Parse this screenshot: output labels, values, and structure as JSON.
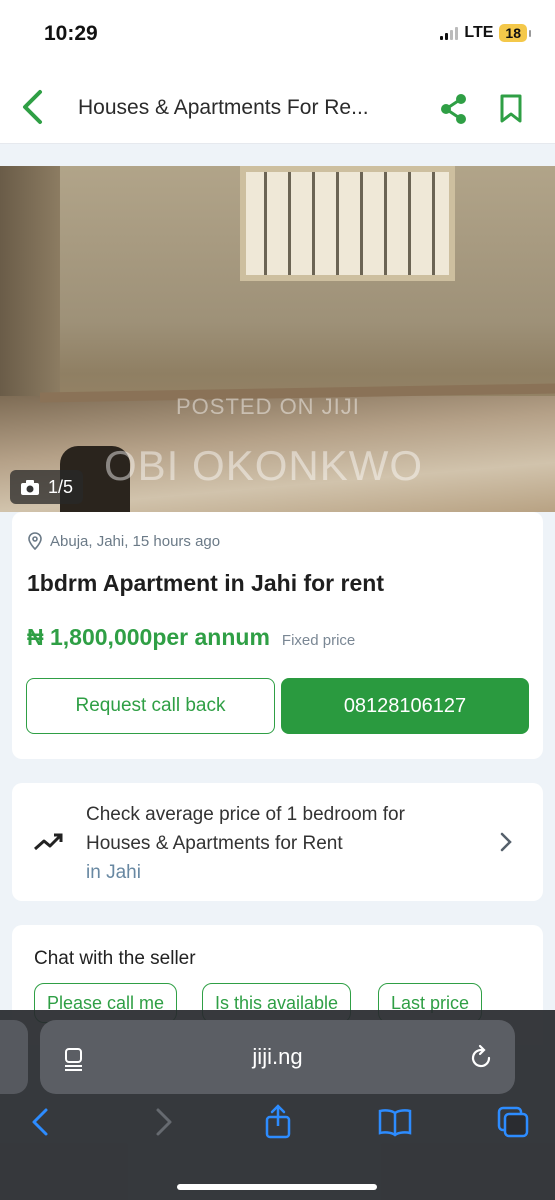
{
  "status_bar": {
    "time": "10:29",
    "network": "LTE",
    "battery": "18"
  },
  "header": {
    "title": "Houses & Apartments For Re...",
    "back_icon": "chevron-left-icon",
    "share_icon": "share-icon",
    "bookmark_icon": "bookmark-icon"
  },
  "gallery": {
    "watermark_line1": "POSTED ON JIJI",
    "watermark_line2": "OBI OKONKWO",
    "counter": "1/5"
  },
  "ad": {
    "location": "Abuja, Jahi, 15 hours ago",
    "title": "1bdrm Apartment in Jahi for rent",
    "price": "₦ 1,800,000per annum",
    "price_note": "Fixed price",
    "request_callback_label": "Request call back",
    "phone_label": "08128106127"
  },
  "avg_price": {
    "line1": "Check average price of 1 bedroom for",
    "line2": "Houses & Apartments for Rent",
    "line3": "in Jahi"
  },
  "chat": {
    "title": "Chat with the seller",
    "chips": [
      "Please call me",
      "Is this available",
      "Last price"
    ]
  },
  "browser": {
    "url": "jiji.ng"
  },
  "colors": {
    "accent": "#2f9f45",
    "background": "#eef3f8",
    "browser_bar": "#2a2c30"
  }
}
